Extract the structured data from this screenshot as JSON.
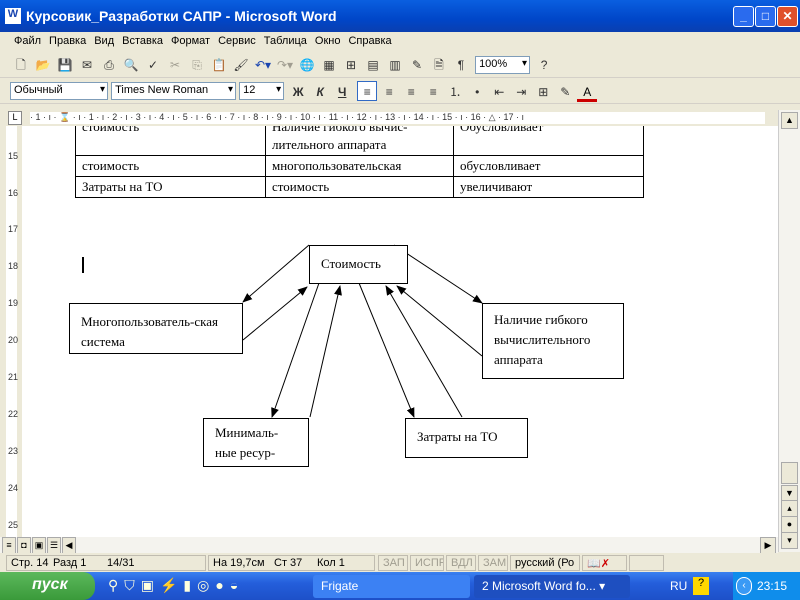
{
  "window": {
    "title": "Курсовик_Разработки САПР - Microsoft Word",
    "app_icon": "word-icon"
  },
  "menu": [
    "Файл",
    "Правка",
    "Вид",
    "Вставка",
    "Формат",
    "Сервис",
    "Таблица",
    "Окно",
    "Справка"
  ],
  "toolbar": {
    "zoom": "100%"
  },
  "format": {
    "style": "Обычный",
    "font": "Times New Roman",
    "size": "12",
    "bold": "Ж",
    "italic": "К",
    "underline": "Ч"
  },
  "ruler": {
    "h": "· 1 · ı · ⌛ · ı · 1 · ı · 2 · ı · 3 · ı · 4 · ı · 5 · ı · 6 · ı · 7 · ı · 8 · ı · 9 · ı · 10 · ı · 11 · ı · 12 · ı · 13 · ı · 14 · ı · 15 · ı · 16 · △ · 17 · ı",
    "v": [
      "15",
      "16",
      "17",
      "18",
      "19",
      "20",
      "21",
      "22",
      "23",
      "24",
      "25"
    ]
  },
  "table": [
    [
      "стоимость",
      "Наличие гибкого вычис-лительного аппарата",
      "Обусловливает"
    ],
    [
      "стоимость",
      "многопользовательская",
      "обусловливает"
    ],
    [
      "Затраты на ТО",
      "стоимость",
      "увеличивают"
    ]
  ],
  "diagram": {
    "center": "Стоимость",
    "left": "Многопользователь-ская система",
    "right": "Наличие гибкого вычислительного аппарата",
    "bottom_left": "Минималь-ные ресур-",
    "bottom_right": "Затраты на ТО"
  },
  "status": {
    "page": "Стр. 14",
    "section": "Разд 1",
    "pages": "14/31",
    "at": "На 19,7см",
    "line": "Ст 37",
    "col": "Кол 1",
    "rec": "ЗАП",
    "trk": "ИСПР",
    "ext": "ВДЛ",
    "ovr": "ЗАМ",
    "lang": "русский (Ро"
  },
  "taskbar": {
    "start": "пуск",
    "tasks": [
      "Frigate",
      "2 Microsoft Word fo..."
    ],
    "lang": "RU",
    "clock": "23:15"
  }
}
